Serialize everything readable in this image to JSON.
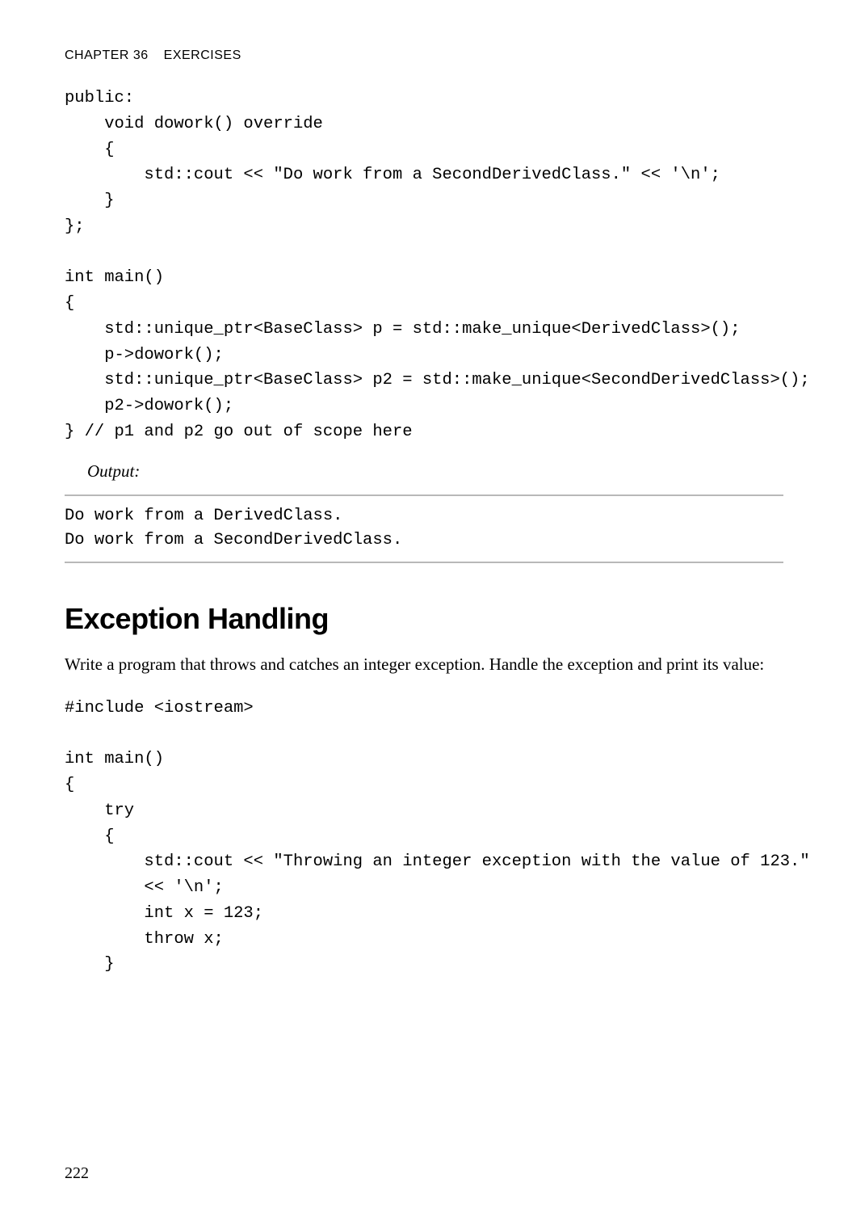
{
  "header": {
    "chapter": "CHAPTER 36",
    "title": "EXERCISES"
  },
  "code_block_1": "public:\n    void dowork() override\n    {\n        std::cout << \"Do work from a SecondDerivedClass.\" << '\\n';\n    }\n};\n\nint main()\n{\n    std::unique_ptr<BaseClass> p = std::make_unique<DerivedClass>();\n    p->dowork();\n    std::unique_ptr<BaseClass> p2 = std::make_unique<SecondDerivedClass>();\n    p2->dowork();\n} // p1 and p2 go out of scope here",
  "output_label": "Output:",
  "output_text": "Do work from a DerivedClass.\nDo work from a SecondDerivedClass.",
  "section_heading": "Exception Handling",
  "section_body": "Write a program that throws and catches an integer exception. Handle the exception and print its value:",
  "code_block_2": "#include <iostream>\n\nint main()\n{\n    try\n    {\n        std::cout << \"Throwing an integer exception with the value of 123.\" \n        << '\\n';\n        int x = 123;\n        throw x;\n    }",
  "page_number": "222"
}
